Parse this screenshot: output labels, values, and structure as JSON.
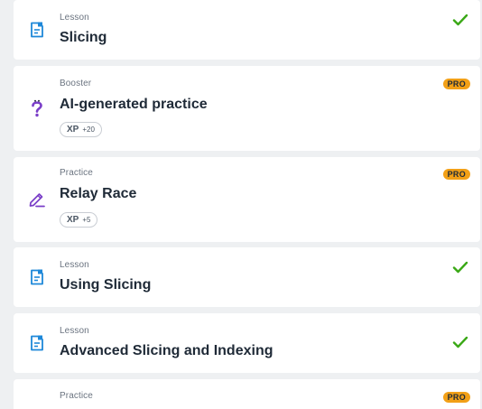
{
  "items": [
    {
      "kind": "Lesson",
      "title": "Slicing"
    },
    {
      "kind": "Booster",
      "title": "AI-generated practice",
      "xp_label": "XP",
      "xp_value": "+20",
      "badge": "PRO"
    },
    {
      "kind": "Practice",
      "title": "Relay Race",
      "xp_label": "XP",
      "xp_value": "+5",
      "badge": "PRO"
    },
    {
      "kind": "Lesson",
      "title": "Using Slicing"
    },
    {
      "kind": "Lesson",
      "title": "Advanced Slicing and Indexing"
    },
    {
      "kind": "Practice",
      "badge": "PRO"
    }
  ],
  "colors": {
    "lesson_icon": "#1e88d9",
    "booster_icon": "#7a3ec8",
    "practice_icon": "#7a3ec8",
    "check": "#3aa816",
    "pro_badge": "#f2a017"
  },
  "icons": {
    "lesson": "lesson-document-icon",
    "booster": "question-mark-icon",
    "practice": "pencil-icon",
    "completed": "checkmark-icon"
  }
}
